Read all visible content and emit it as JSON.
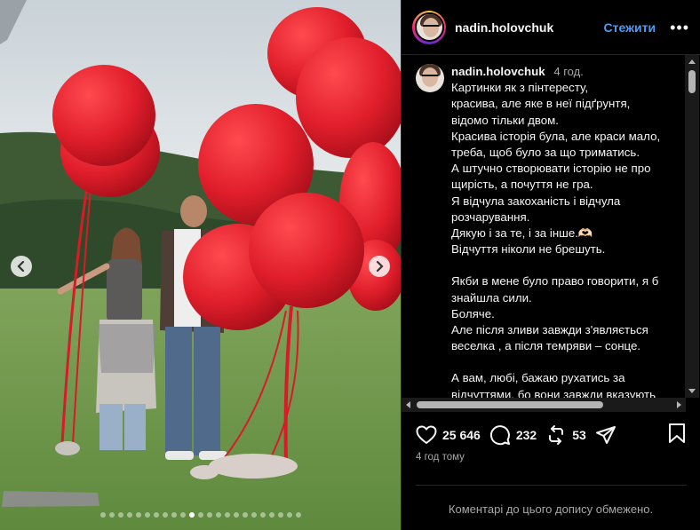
{
  "post": {
    "username": "nadin.holovchuk",
    "follow_label": "Стежити",
    "more_label": "•••",
    "time_short": "4 год.",
    "time_ago": "4 год тому",
    "caption_lines": [
      "Картинки як з пінтересту,",
      "красива, але яке в неї підґрунтя,",
      "відомо тільки двом.",
      "Красива історія була, але краси мало,",
      "треба, щоб було за що триматись.",
      "А штучно створювати історію не про",
      "щирість, а почуття не гра.",
      "Я відчула закоханість і відчула",
      "розчарування.",
      "Дякую і за те, і за інше.🫶🏻",
      "Відчуття ніколи не брешуть.",
      "",
      "Якби в мене було право говорити, я б",
      "знайшла сили.",
      "Боляче.",
      "Але після зливи завжди з'являється",
      "веселка , а після темряви – сонце.",
      "",
      "А вам, любі, бажаю рухатись за",
      "відчуттями, бо вони завжди вказують"
    ],
    "likes": "25 646",
    "comments": "232",
    "reposts": "53",
    "comments_disabled_text": "Коментарі до цього допису обмежено."
  },
  "carousel": {
    "dot_count": 23,
    "active_index": 10
  },
  "colors": {
    "accent": "#4a9df8",
    "balloon_red": "#e01e2b",
    "background": "#000000"
  }
}
